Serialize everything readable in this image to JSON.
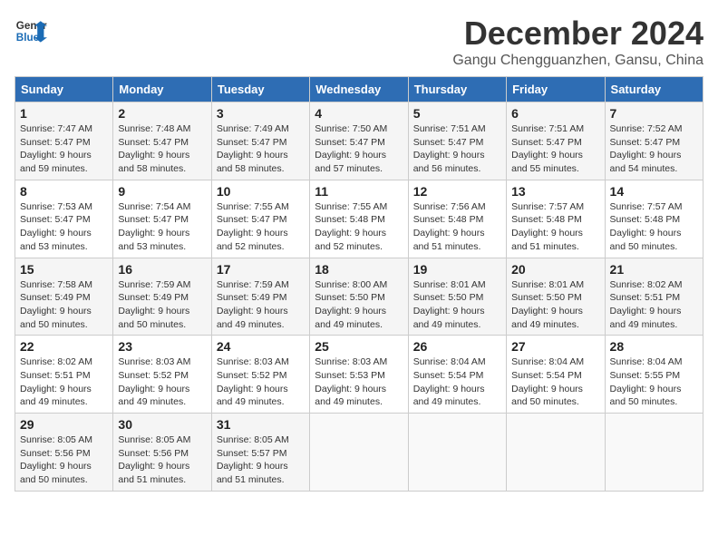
{
  "logo": {
    "line1": "General",
    "line2": "Blue"
  },
  "title": "December 2024",
  "location": "Gangu Chengguanzhen, Gansu, China",
  "headers": [
    "Sunday",
    "Monday",
    "Tuesday",
    "Wednesday",
    "Thursday",
    "Friday",
    "Saturday"
  ],
  "weeks": [
    [
      {
        "day": "1",
        "info": "Sunrise: 7:47 AM\nSunset: 5:47 PM\nDaylight: 9 hours\nand 59 minutes."
      },
      {
        "day": "2",
        "info": "Sunrise: 7:48 AM\nSunset: 5:47 PM\nDaylight: 9 hours\nand 58 minutes."
      },
      {
        "day": "3",
        "info": "Sunrise: 7:49 AM\nSunset: 5:47 PM\nDaylight: 9 hours\nand 58 minutes."
      },
      {
        "day": "4",
        "info": "Sunrise: 7:50 AM\nSunset: 5:47 PM\nDaylight: 9 hours\nand 57 minutes."
      },
      {
        "day": "5",
        "info": "Sunrise: 7:51 AM\nSunset: 5:47 PM\nDaylight: 9 hours\nand 56 minutes."
      },
      {
        "day": "6",
        "info": "Sunrise: 7:51 AM\nSunset: 5:47 PM\nDaylight: 9 hours\nand 55 minutes."
      },
      {
        "day": "7",
        "info": "Sunrise: 7:52 AM\nSunset: 5:47 PM\nDaylight: 9 hours\nand 54 minutes."
      }
    ],
    [
      {
        "day": "8",
        "info": "Sunrise: 7:53 AM\nSunset: 5:47 PM\nDaylight: 9 hours\nand 53 minutes."
      },
      {
        "day": "9",
        "info": "Sunrise: 7:54 AM\nSunset: 5:47 PM\nDaylight: 9 hours\nand 53 minutes."
      },
      {
        "day": "10",
        "info": "Sunrise: 7:55 AM\nSunset: 5:47 PM\nDaylight: 9 hours\nand 52 minutes."
      },
      {
        "day": "11",
        "info": "Sunrise: 7:55 AM\nSunset: 5:48 PM\nDaylight: 9 hours\nand 52 minutes."
      },
      {
        "day": "12",
        "info": "Sunrise: 7:56 AM\nSunset: 5:48 PM\nDaylight: 9 hours\nand 51 minutes."
      },
      {
        "day": "13",
        "info": "Sunrise: 7:57 AM\nSunset: 5:48 PM\nDaylight: 9 hours\nand 51 minutes."
      },
      {
        "day": "14",
        "info": "Sunrise: 7:57 AM\nSunset: 5:48 PM\nDaylight: 9 hours\nand 50 minutes."
      }
    ],
    [
      {
        "day": "15",
        "info": "Sunrise: 7:58 AM\nSunset: 5:49 PM\nDaylight: 9 hours\nand 50 minutes."
      },
      {
        "day": "16",
        "info": "Sunrise: 7:59 AM\nSunset: 5:49 PM\nDaylight: 9 hours\nand 50 minutes."
      },
      {
        "day": "17",
        "info": "Sunrise: 7:59 AM\nSunset: 5:49 PM\nDaylight: 9 hours\nand 49 minutes."
      },
      {
        "day": "18",
        "info": "Sunrise: 8:00 AM\nSunset: 5:50 PM\nDaylight: 9 hours\nand 49 minutes."
      },
      {
        "day": "19",
        "info": "Sunrise: 8:01 AM\nSunset: 5:50 PM\nDaylight: 9 hours\nand 49 minutes."
      },
      {
        "day": "20",
        "info": "Sunrise: 8:01 AM\nSunset: 5:50 PM\nDaylight: 9 hours\nand 49 minutes."
      },
      {
        "day": "21",
        "info": "Sunrise: 8:02 AM\nSunset: 5:51 PM\nDaylight: 9 hours\nand 49 minutes."
      }
    ],
    [
      {
        "day": "22",
        "info": "Sunrise: 8:02 AM\nSunset: 5:51 PM\nDaylight: 9 hours\nand 49 minutes."
      },
      {
        "day": "23",
        "info": "Sunrise: 8:03 AM\nSunset: 5:52 PM\nDaylight: 9 hours\nand 49 minutes."
      },
      {
        "day": "24",
        "info": "Sunrise: 8:03 AM\nSunset: 5:52 PM\nDaylight: 9 hours\nand 49 minutes."
      },
      {
        "day": "25",
        "info": "Sunrise: 8:03 AM\nSunset: 5:53 PM\nDaylight: 9 hours\nand 49 minutes."
      },
      {
        "day": "26",
        "info": "Sunrise: 8:04 AM\nSunset: 5:54 PM\nDaylight: 9 hours\nand 49 minutes."
      },
      {
        "day": "27",
        "info": "Sunrise: 8:04 AM\nSunset: 5:54 PM\nDaylight: 9 hours\nand 50 minutes."
      },
      {
        "day": "28",
        "info": "Sunrise: 8:04 AM\nSunset: 5:55 PM\nDaylight: 9 hours\nand 50 minutes."
      }
    ],
    [
      {
        "day": "29",
        "info": "Sunrise: 8:05 AM\nSunset: 5:56 PM\nDaylight: 9 hours\nand 50 minutes."
      },
      {
        "day": "30",
        "info": "Sunrise: 8:05 AM\nSunset: 5:56 PM\nDaylight: 9 hours\nand 51 minutes."
      },
      {
        "day": "31",
        "info": "Sunrise: 8:05 AM\nSunset: 5:57 PM\nDaylight: 9 hours\nand 51 minutes."
      },
      {
        "day": "",
        "info": ""
      },
      {
        "day": "",
        "info": ""
      },
      {
        "day": "",
        "info": ""
      },
      {
        "day": "",
        "info": ""
      }
    ]
  ]
}
